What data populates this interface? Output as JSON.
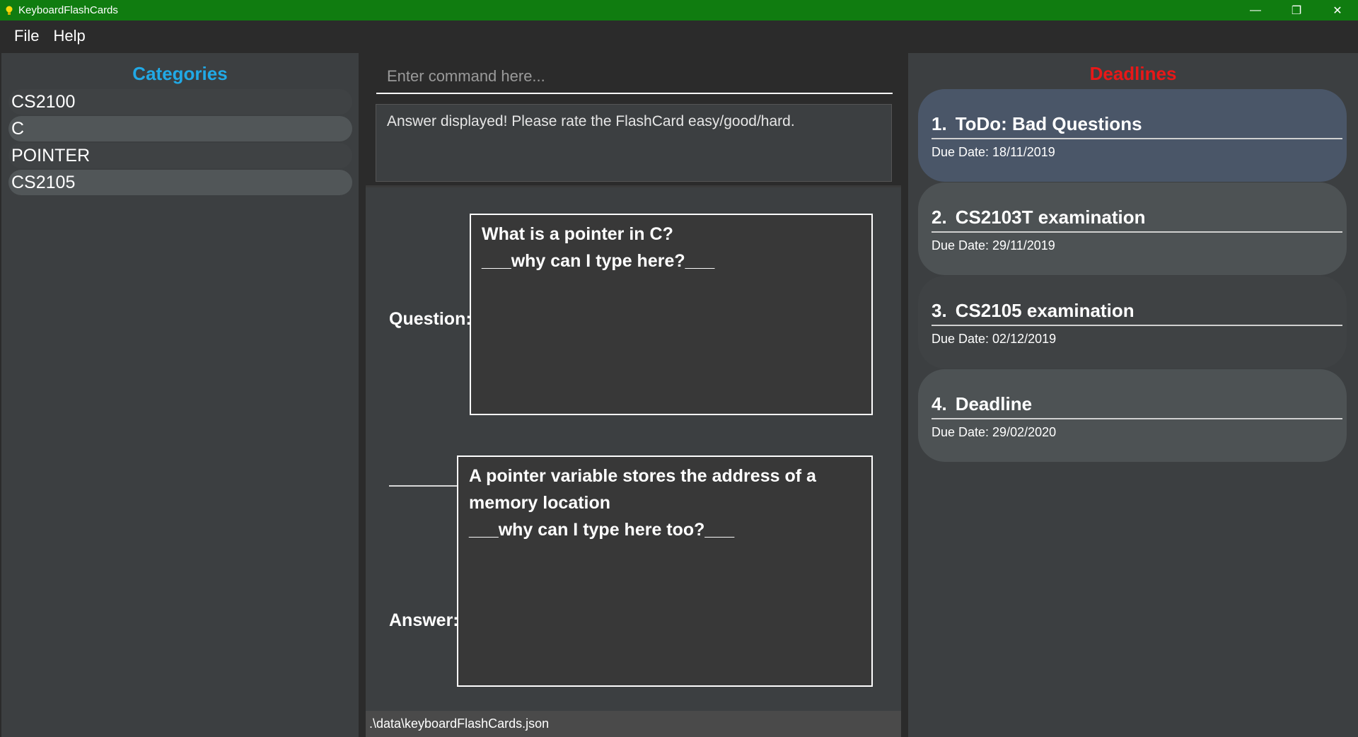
{
  "window": {
    "title": "KeyboardFlashCards",
    "controls": {
      "minimize": "—",
      "maximize": "❐",
      "close": "✕"
    }
  },
  "menu": {
    "file": "File",
    "help": "Help"
  },
  "categories": {
    "title": "Categories",
    "items": [
      "CS2100",
      "C",
      "POINTER",
      "CS2105"
    ]
  },
  "command": {
    "placeholder": "Enter command here..."
  },
  "result": {
    "text": "Answer displayed! Please rate the FlashCard easy/good/hard."
  },
  "flashcard": {
    "question_label": "Question:",
    "question_text": "What is a pointer in C?\n___why can I type here?___",
    "answer_label": "Answer:",
    "answer_text": "A pointer variable stores the address of a\nmemory location\n___why can I type here too?___"
  },
  "status": {
    "path": ".\\data\\keyboardFlashCards.json"
  },
  "deadlines": {
    "title": "Deadlines",
    "items": [
      {
        "num": "1.",
        "name": "ToDo: Bad Questions",
        "due": "Due Date: 18/11/2019"
      },
      {
        "num": "2.",
        "name": "CS2103T examination",
        "due": "Due Date: 29/11/2019"
      },
      {
        "num": "3.",
        "name": "CS2105 examination",
        "due": "Due Date: 02/12/2019"
      },
      {
        "num": "4.",
        "name": "Deadline",
        "due": "Due Date: 29/02/2020"
      }
    ]
  },
  "colors": {
    "titlebar": "#107c10",
    "categories_title": "#21a9e6",
    "deadlines_title": "#e81818"
  }
}
